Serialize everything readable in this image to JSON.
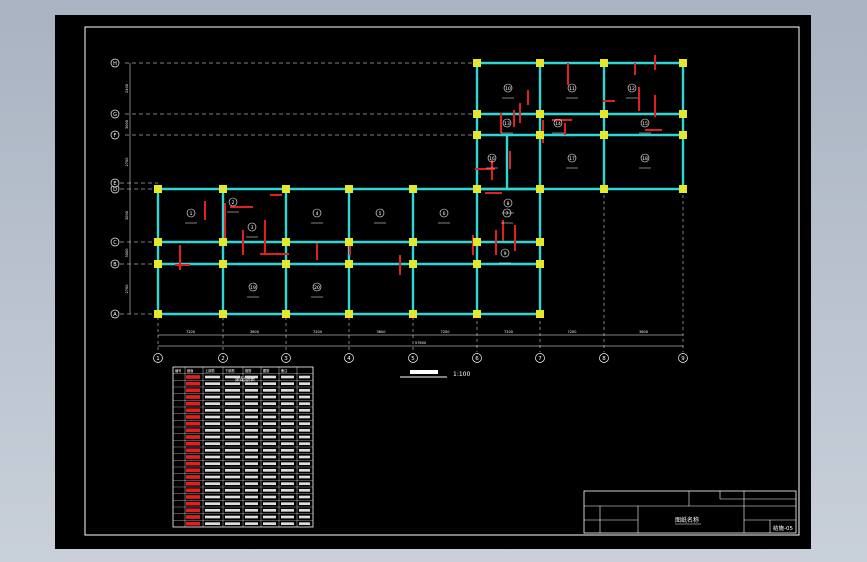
{
  "drawing": {
    "scale_label": "1:100",
    "title_cell_text": "图纸名称",
    "sheet_code": "结施-05",
    "colors": {
      "sheet_bg": "#000000",
      "beam": "#2fd6d6",
      "column": "#e6e62a",
      "rebar": "#e02020",
      "grid": "#ffffff",
      "frame": "#ffffff"
    }
  },
  "grid_axes": {
    "vertical_labels": [
      "1",
      "2",
      "3",
      "4",
      "5",
      "6",
      "7",
      "8",
      "9"
    ],
    "horizontal_labels": [
      "A",
      "B",
      "C",
      "D",
      "E",
      "F",
      "G",
      "H"
    ]
  },
  "dimensions": {
    "bottom_spans": [
      "7200",
      "3600",
      "7200",
      "3600",
      "7200",
      "7200",
      "7200",
      "3600",
      "4500"
    ],
    "total_length": "57600",
    "left_spans": [
      "2400",
      "3000",
      "2700",
      "3000",
      "3000",
      "2700"
    ]
  },
  "room_numbers": [
    "1",
    "2",
    "3",
    "4",
    "5",
    "6",
    "7",
    "8",
    "9",
    "10",
    "11",
    "12",
    "13",
    "14",
    "15",
    "16",
    "17",
    "18",
    "19",
    "20"
  ],
  "beam_table": {
    "title": "梁配筋表",
    "headers": [
      "编号",
      "截面",
      "上部筋",
      "下部筋",
      "箍筋",
      "腰筋",
      "备注"
    ],
    "row_count": 24
  }
}
